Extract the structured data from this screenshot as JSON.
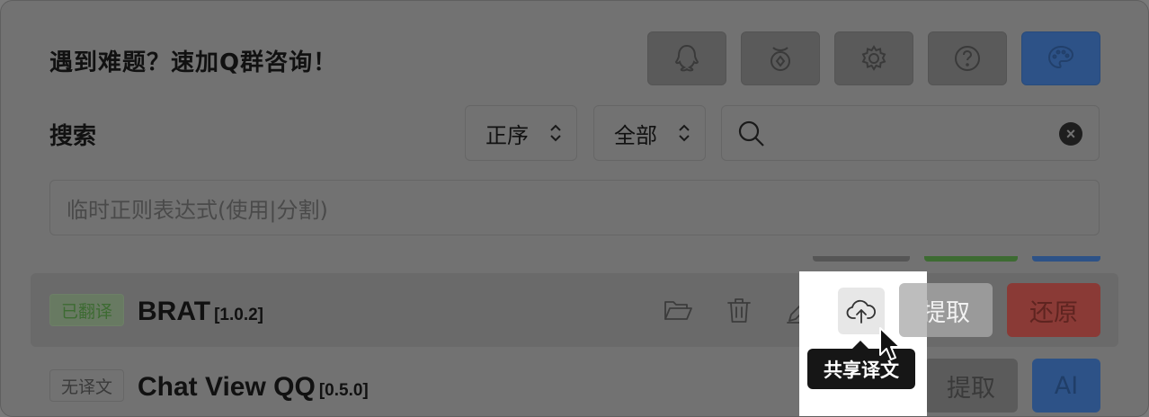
{
  "header": {
    "title": "遇到难题？速加Q群咨询！",
    "buttons": [
      {
        "name": "qq-button",
        "icon": "qq-penguin-icon"
      },
      {
        "name": "donate-button",
        "icon": "coin-pouch-icon"
      },
      {
        "name": "settings-button",
        "icon": "gear-icon"
      },
      {
        "name": "help-button",
        "icon": "question-circle-icon"
      },
      {
        "name": "theme-button",
        "icon": "palette-icon"
      }
    ]
  },
  "search": {
    "label": "搜索",
    "sort_value": "正序",
    "filter_value": "全部",
    "query": "",
    "regex_placeholder": "临时正则表达式(使用|分割)"
  },
  "plugins": [
    {
      "status": "已翻译",
      "name": "BRAT",
      "version": "[1.0.2]",
      "actions": {
        "primary": "提取",
        "secondary": "还原"
      }
    },
    {
      "status": "无译文",
      "name": "Chat View QQ",
      "version": "[0.5.0]",
      "actions": {
        "primary": "提取",
        "secondary": "AI"
      }
    }
  ],
  "tooltip": "共享译文",
  "colors": {
    "dim_overlay": "#727272",
    "accent_blue": "#2d5287",
    "danger_red": "#8a3a36",
    "success_green": "#3d6b32",
    "tooltip_bg": "#161616"
  }
}
